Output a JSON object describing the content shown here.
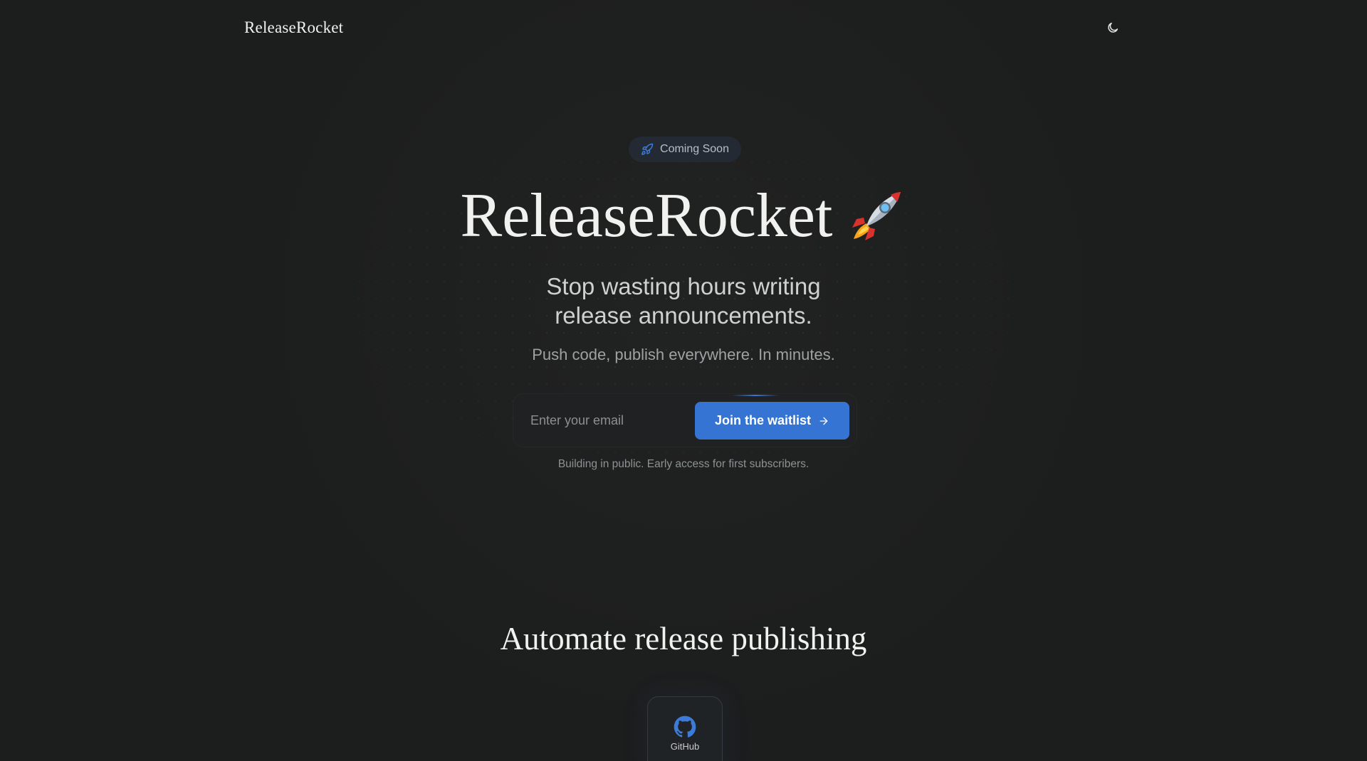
{
  "nav": {
    "brand": "ReleaseRocket",
    "theme_toggle_icon": "moon-icon"
  },
  "hero": {
    "badge": {
      "icon": "rocket-icon",
      "label": "Coming Soon"
    },
    "title": "ReleaseRocket",
    "title_emoji": "rocket-emoji",
    "subtitle_line1": "Stop wasting hours writing",
    "subtitle_line2": "release announcements.",
    "tagline": "Push code, publish everywhere. In minutes."
  },
  "waitlist": {
    "email_placeholder": "Enter your email",
    "email_value": "",
    "button_label": "Join the waitlist",
    "button_icon": "arrow-right-icon",
    "note": "Building in public. Early access for first subscribers."
  },
  "integrations": {
    "title": "Automate release publishing",
    "items": [
      {
        "label": "GitHub",
        "icon": "github-icon"
      }
    ]
  },
  "colors": {
    "background": "#1c1d1d",
    "accent": "#3674d3",
    "badge_bg": "#232a33",
    "text_primary": "#f1f1ef",
    "text_muted": "#9fa1a3"
  }
}
